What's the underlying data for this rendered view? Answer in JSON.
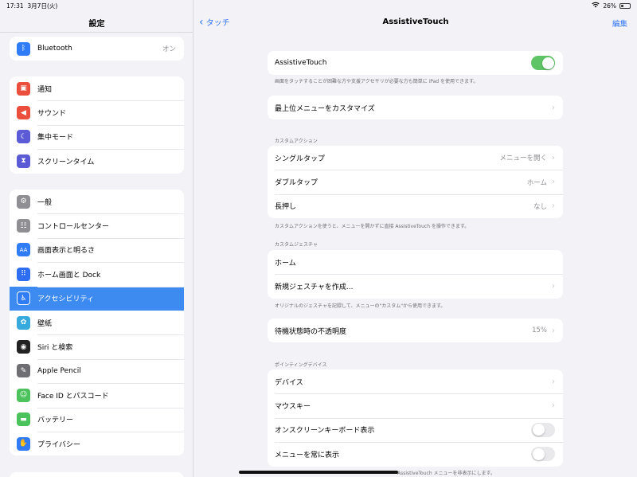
{
  "status": {
    "time": "17:31",
    "date": "3月7日(火)",
    "battery": "26%",
    "battery_level": 0.26
  },
  "sidebar": {
    "title": "設定",
    "group1": [
      {
        "label": "Bluetooth",
        "value": "オン",
        "icon": "bluetooth-icon",
        "color": "#2f7cf6",
        "glyph": "ᛒ"
      }
    ],
    "group2": [
      {
        "label": "通知",
        "icon": "notification-icon",
        "color": "#eb4e3d",
        "glyph": "▣"
      },
      {
        "label": "サウンド",
        "icon": "speaker-icon",
        "color": "#eb4e3d",
        "glyph": "◀"
      },
      {
        "label": "集中モード",
        "icon": "moon-icon",
        "color": "#5b5bd6",
        "glyph": "☾"
      },
      {
        "label": "スクリーンタイム",
        "icon": "hourglass-icon",
        "color": "#5b5bd6",
        "glyph": "⧗"
      }
    ],
    "group3": [
      {
        "label": "一般",
        "icon": "gear-icon",
        "color": "#8e8e93",
        "glyph": "⚙"
      },
      {
        "label": "コントロールセンター",
        "icon": "switches-icon",
        "color": "#8e8e93",
        "glyph": "☷"
      },
      {
        "label": "画面表示と明るさ",
        "icon": "text-size-icon",
        "color": "#2f7cf6",
        "glyph": "AA"
      },
      {
        "label": "ホーム画面と Dock",
        "icon": "home-grid-icon",
        "color": "#2f6ef0",
        "glyph": "⠿"
      },
      {
        "label": "アクセシビリティ",
        "icon": "accessibility-icon",
        "color": "#2f7cf6",
        "glyph": "♿",
        "selected": true
      },
      {
        "label": "壁紙",
        "icon": "flower-icon",
        "color": "#36aadc",
        "glyph": "✿"
      },
      {
        "label": "Siri と検索",
        "icon": "siri-icon",
        "color": "#222222",
        "glyph": "◉"
      },
      {
        "label": "Apple Pencil",
        "icon": "pencil-icon",
        "color": "#6e6e73",
        "glyph": "✎"
      },
      {
        "label": "Face ID とパスコード",
        "icon": "face-id-icon",
        "color": "#4cc25d",
        "glyph": "☺"
      },
      {
        "label": "バッテリー",
        "icon": "battery-icon",
        "color": "#4cc25d",
        "glyph": "▬"
      },
      {
        "label": "プライバシー",
        "icon": "hand-icon",
        "color": "#2f7cf6",
        "glyph": "✋"
      }
    ]
  },
  "main": {
    "back_label": "タッチ",
    "title": "AssistiveTouch",
    "edit_label": "編集",
    "card1": {
      "label": "AssistiveTouch",
      "toggle_on": true
    },
    "card1_footer": "画面をタッチすることが困難な方や支援アクセサリが必要な方も簡単に iPad を使用できます。",
    "card2": {
      "label": "最上位メニューをカスタマイズ"
    },
    "custom_actions_header": "カスタムアクション",
    "custom_actions": [
      {
        "label": "シングルタップ",
        "value": "メニューを開く"
      },
      {
        "label": "ダブルタップ",
        "value": "ホーム"
      },
      {
        "label": "長押し",
        "value": "なし"
      }
    ],
    "custom_actions_footer": "カスタムアクションを使うと、メニューを開かずに直接 AssistiveTouch を操作できます。",
    "custom_gestures_header": "カスタムジェスチャ",
    "custom_gestures": [
      {
        "label": "ホーム"
      },
      {
        "label": "新規ジェスチャを作成..."
      }
    ],
    "custom_gestures_footer": "オリジナルのジェスチャを記録して、メニューの\"カスタム\"から使用できます。",
    "idle_opacity": {
      "label": "待機状態時の不透明度",
      "value": "15%"
    },
    "pointing_header": "ポインティングデバイス",
    "pointing": [
      {
        "label": "デバイス"
      },
      {
        "label": "マウスキー"
      },
      {
        "label": "オンスクリーンキーボード表示",
        "toggle_on": false
      },
      {
        "label": "メニューを常に表示",
        "toggle_on": false
      }
    ],
    "pointing_footer": "AssistiveTouch メニューを非表示にします。"
  },
  "colors": {
    "accent": "#3478f6",
    "toggle_on": "#5fc466",
    "selected_row": "#3d8bf0"
  }
}
